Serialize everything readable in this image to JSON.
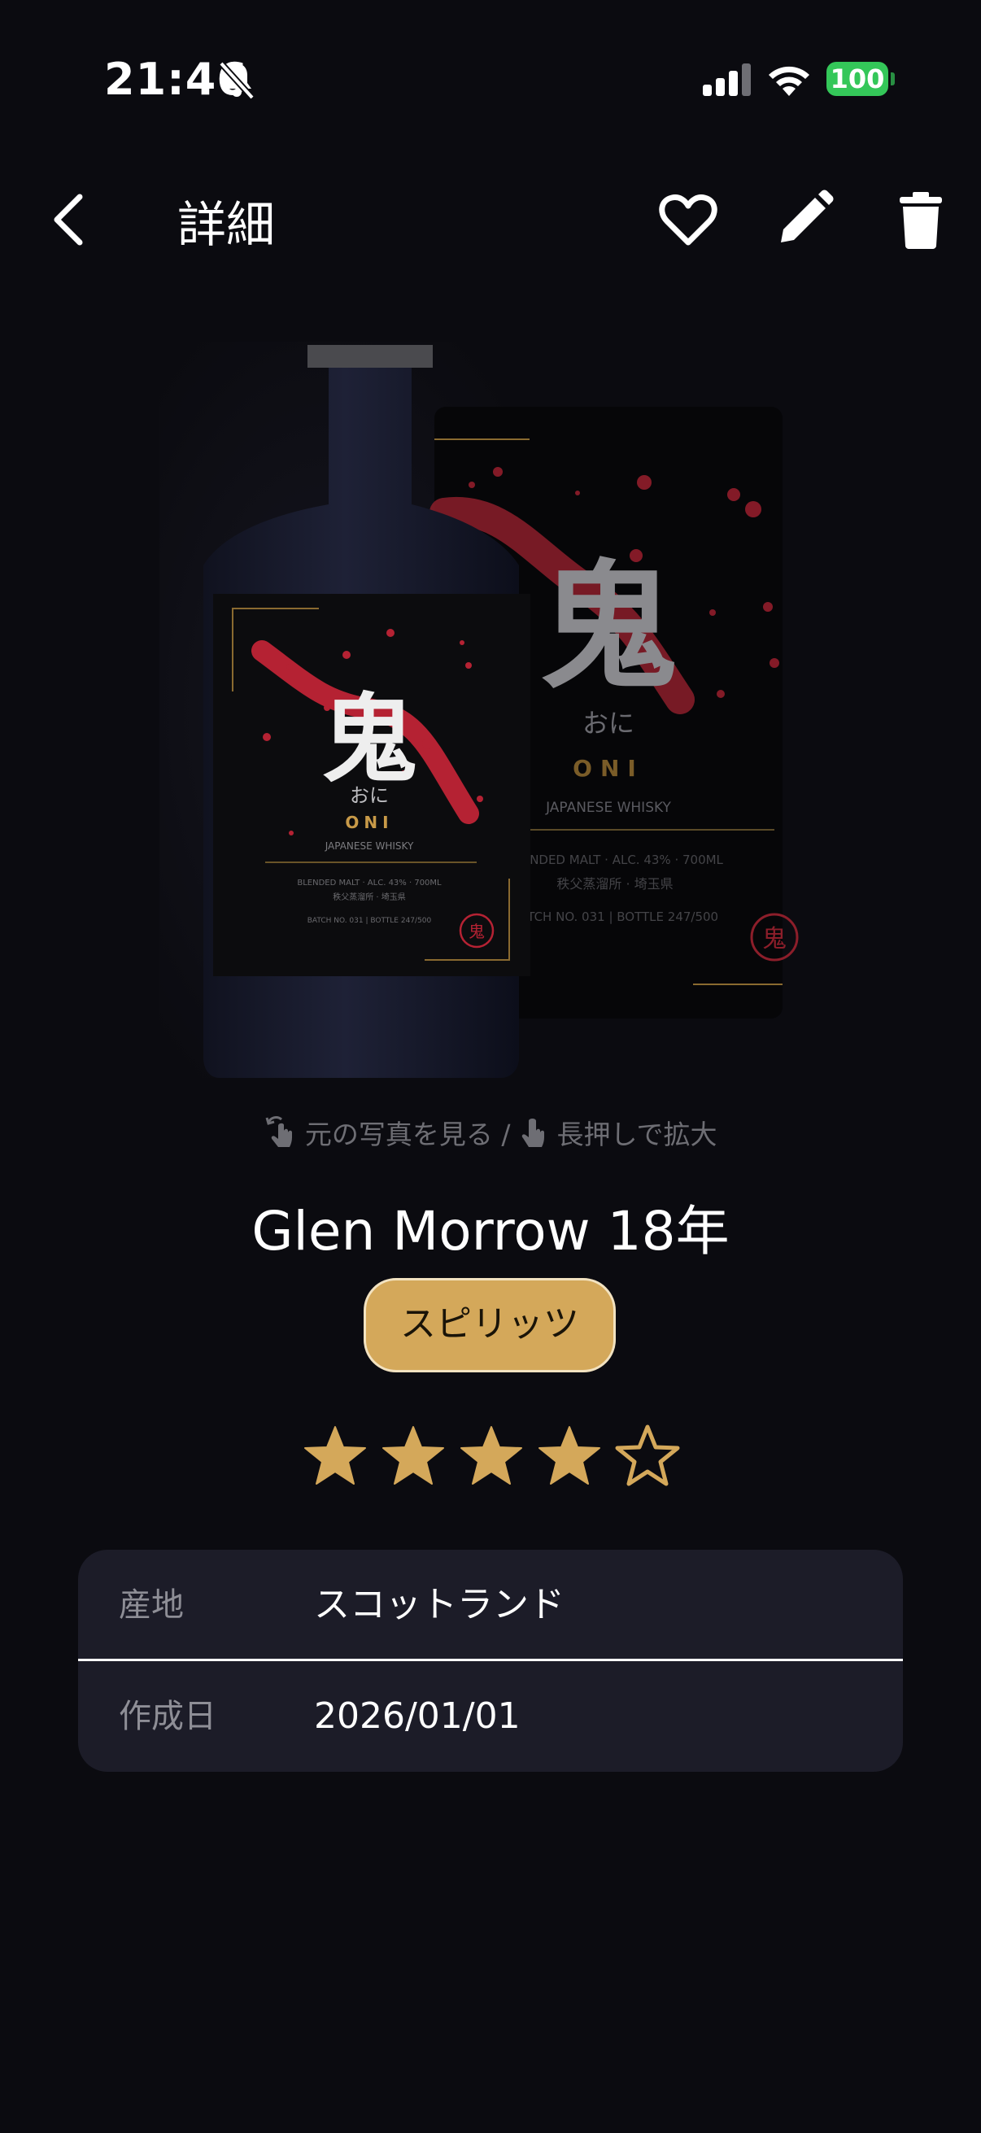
{
  "status_bar": {
    "time": "21:46",
    "battery": "100",
    "icons": [
      "bell-slash-icon",
      "signal-icon",
      "wifi-icon",
      "battery-icon"
    ]
  },
  "nav": {
    "title": "詳細",
    "icons": [
      "chevron-left-icon",
      "heart-icon",
      "pencil-icon",
      "trash-icon"
    ]
  },
  "label_art": {
    "kanji": "鬼",
    "kana": "おに",
    "brand": "ONI",
    "type": "JAPANESE WHISKY",
    "specs": "BLENDED MALT · ALC. 43% · 700ML",
    "origin": "秩父蒸溜所 · 埼玉県",
    "batch": "BATCH NO. 031 | BOTTLE 247/500",
    "seal": "鬼"
  },
  "hint": {
    "view_original": "元の写真を見る",
    "separator": "/",
    "long_press": "長押しで拡大"
  },
  "product": {
    "name": "Glen Morrow 18年",
    "category": "スピリッツ",
    "rating": 4,
    "max_rating": 5
  },
  "details": [
    {
      "label": "産地",
      "value": "スコットランド"
    },
    {
      "label": "作成日",
      "value": "2026/01/01"
    }
  ],
  "colors": {
    "background": "#0b0b10",
    "accent_gold": "#d4a85a",
    "card": "#1c1c28",
    "label_red": "#c0283a"
  }
}
